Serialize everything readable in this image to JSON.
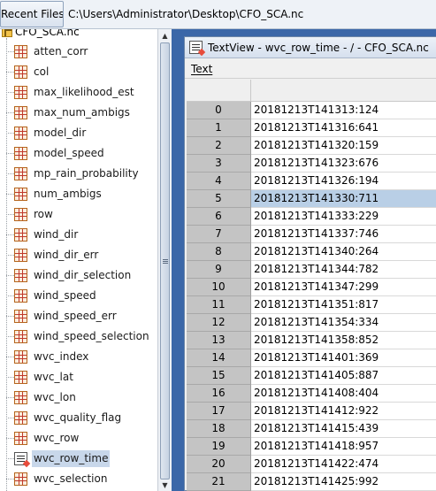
{
  "toolbar": {
    "recent_files_label": "Recent Files",
    "file_path": "C:\\Users\\Administrator\\Desktop\\CFO_SCA.nc"
  },
  "tree": {
    "root_label": "CFO_SCA.nc",
    "items": [
      {
        "label": "atten_corr",
        "icon": "dataset-grid-icon"
      },
      {
        "label": "col",
        "icon": "dataset-grid-icon"
      },
      {
        "label": "max_likelihood_est",
        "icon": "dataset-grid-icon"
      },
      {
        "label": "max_num_ambigs",
        "icon": "dataset-grid-icon"
      },
      {
        "label": "model_dir",
        "icon": "dataset-grid-icon"
      },
      {
        "label": "model_speed",
        "icon": "dataset-grid-icon"
      },
      {
        "label": "mp_rain_probability",
        "icon": "dataset-grid-icon"
      },
      {
        "label": "num_ambigs",
        "icon": "dataset-grid-icon"
      },
      {
        "label": "row",
        "icon": "dataset-grid-icon"
      },
      {
        "label": "wind_dir",
        "icon": "dataset-grid-icon"
      },
      {
        "label": "wind_dir_err",
        "icon": "dataset-grid-icon"
      },
      {
        "label": "wind_dir_selection",
        "icon": "dataset-grid-icon"
      },
      {
        "label": "wind_speed",
        "icon": "dataset-grid-icon"
      },
      {
        "label": "wind_speed_err",
        "icon": "dataset-grid-icon"
      },
      {
        "label": "wind_speed_selection",
        "icon": "dataset-grid-icon"
      },
      {
        "label": "wvc_index",
        "icon": "dataset-grid-icon"
      },
      {
        "label": "wvc_lat",
        "icon": "dataset-grid-icon"
      },
      {
        "label": "wvc_lon",
        "icon": "dataset-grid-icon"
      },
      {
        "label": "wvc_quality_flag",
        "icon": "dataset-grid-icon"
      },
      {
        "label": "wvc_row",
        "icon": "dataset-grid-icon"
      },
      {
        "label": "wvc_row_time",
        "icon": "text-dataset-icon",
        "selected": true
      },
      {
        "label": "wvc_selection",
        "icon": "dataset-grid-icon"
      }
    ]
  },
  "textview": {
    "title": "TextView  -  wvc_row_time  -  /  -  CFO_SCA.nc",
    "menu_text": "Text",
    "selected_row": 5,
    "rows": [
      {
        "index": "0",
        "value": "20181213T141313:124"
      },
      {
        "index": "1",
        "value": "20181213T141316:641"
      },
      {
        "index": "2",
        "value": "20181213T141320:159"
      },
      {
        "index": "3",
        "value": "20181213T141323:676"
      },
      {
        "index": "4",
        "value": "20181213T141326:194"
      },
      {
        "index": "5",
        "value": "20181213T141330:711"
      },
      {
        "index": "6",
        "value": "20181213T141333:229"
      },
      {
        "index": "7",
        "value": "20181213T141337:746"
      },
      {
        "index": "8",
        "value": "20181213T141340:264"
      },
      {
        "index": "9",
        "value": "20181213T141344:782"
      },
      {
        "index": "10",
        "value": "20181213T141347:299"
      },
      {
        "index": "11",
        "value": "20181213T141351:817"
      },
      {
        "index": "12",
        "value": "20181213T141354:334"
      },
      {
        "index": "13",
        "value": "20181213T141358:852"
      },
      {
        "index": "14",
        "value": "20181213T141401:369"
      },
      {
        "index": "15",
        "value": "20181213T141405:887"
      },
      {
        "index": "16",
        "value": "20181213T141408:404"
      },
      {
        "index": "17",
        "value": "20181213T141412:922"
      },
      {
        "index": "18",
        "value": "20181213T141415:439"
      },
      {
        "index": "19",
        "value": "20181213T141418:957"
      },
      {
        "index": "20",
        "value": "20181213T141422:474"
      },
      {
        "index": "21",
        "value": "20181213T141425:992"
      }
    ]
  },
  "colors": {
    "workspace_bg": "#3b67a8",
    "selection": "#b9cfe6",
    "row_header": "#c4c4c4"
  }
}
